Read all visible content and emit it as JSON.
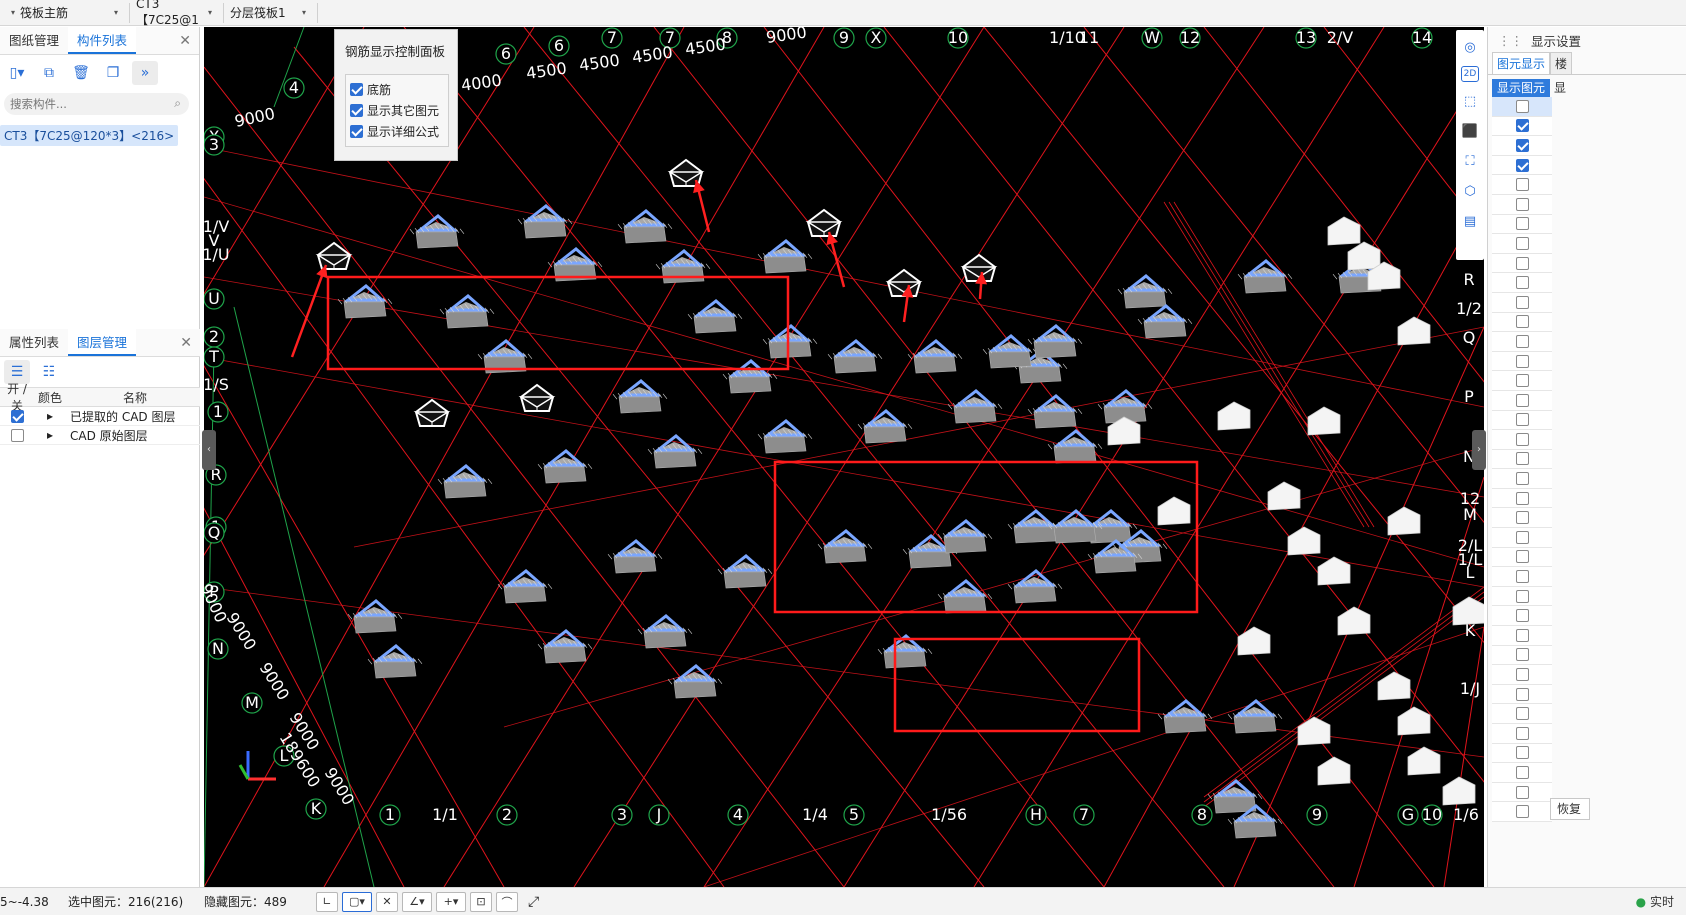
{
  "toolbar": {
    "combos": [
      {
        "label": "筏板主筋"
      },
      {
        "label": "CT3【7C25@1"
      },
      {
        "label": "分层筏板1"
      }
    ]
  },
  "left_panel": {
    "top_tabs": [
      "图纸管理",
      "构件列表"
    ],
    "search_placeholder": "搜索构件...",
    "component_item": "CT3【7C25@120*3】<216>",
    "bottom_tabs": [
      "属性列表",
      "图层管理"
    ],
    "layer_headers": {
      "onoff": "开 / 关",
      "color": "颜色",
      "name": "名称"
    },
    "layers": [
      {
        "on": true,
        "name": "已提取的 CAD 图层"
      },
      {
        "on": false,
        "name": "CAD 原始图层"
      }
    ]
  },
  "control_panel": {
    "title": "钢筋显示控制面板",
    "options": [
      {
        "label": "底筋",
        "checked": true
      },
      {
        "label": "显示其它图元",
        "checked": true
      },
      {
        "label": "显示详细公式",
        "checked": true
      }
    ]
  },
  "axis_labels": {
    "top": [
      "4",
      "6",
      "6",
      "7",
      "7",
      "8",
      "9",
      "X",
      "10",
      "1/10",
      "11",
      "W",
      "12",
      "13",
      "2/V",
      "14"
    ],
    "left": [
      "X",
      "3",
      "1/V",
      "V",
      "1/U",
      "U",
      "2",
      "T",
      "1/S",
      "1",
      "R",
      "1",
      "Q",
      "P",
      "N",
      "M",
      "L",
      "K"
    ],
    "bottom": [
      "1",
      "1/1",
      "2",
      "3",
      "J",
      "4",
      "1/4",
      "5",
      "1/5",
      "6",
      "H",
      "7",
      "8",
      "9",
      "G",
      "10",
      "1/6"
    ],
    "right": [
      "R",
      "1/2",
      "Q",
      "P",
      "N",
      "12",
      "M",
      "2/L",
      "1/L",
      "L",
      "K",
      "1/J"
    ]
  },
  "dimensions": {
    "top": [
      "9000",
      "4000",
      "4500",
      "4500",
      "4500",
      "4500",
      "9000"
    ],
    "left": [
      "9000",
      "9000",
      "9000",
      "9000",
      "189600",
      "9000"
    ]
  },
  "view_tools": [
    "orbit-icon",
    "2d-icon",
    "3d-box-icon",
    "3d-solid-icon",
    "fullscreen-icon",
    "cube-view-icon",
    "display-settings-icon"
  ],
  "right_panel": {
    "title": "显示设置",
    "tabs": [
      "图元显示",
      "楼"
    ],
    "col_headers": [
      "显示图元",
      "显"
    ],
    "checks": [
      false,
      true,
      true,
      true,
      false,
      false,
      false,
      false,
      false,
      false,
      false,
      false,
      false,
      false,
      false,
      false,
      false,
      false,
      false,
      false,
      false,
      false,
      false,
      false,
      false,
      false,
      false,
      false,
      false,
      false,
      false,
      false,
      false,
      false,
      false,
      false,
      false
    ],
    "restore_label": "恢复"
  },
  "status_bar": {
    "coords": "5~-4.38",
    "selected": "选中图元：216(216)",
    "hidden": "隐藏图元：489",
    "right_status": "实时"
  },
  "colors": {
    "grid": "#e0141c",
    "green_axis": "#1fa34a",
    "accent": "#1a73d9",
    "cap": "#8a8a8a",
    "rebar": "#7aa6ff"
  }
}
